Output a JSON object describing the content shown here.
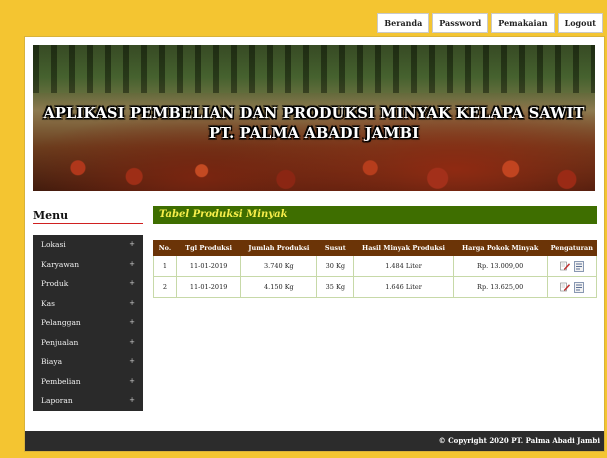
{
  "nav": {
    "items": [
      "Beranda",
      "Password",
      "Pemakaian",
      "Logout"
    ]
  },
  "banner": {
    "title_line1": "APLIKASI PEMBELIAN DAN  PRODUKSI MINYAK KELAPA SAWIT",
    "title_line2": "PT. PALMA ABADI JAMBI"
  },
  "sidebar": {
    "heading": "Menu",
    "items": [
      {
        "label": "Lokasi",
        "expander": "+"
      },
      {
        "label": "Karyawan",
        "expander": "+"
      },
      {
        "label": "Produk",
        "expander": "+"
      },
      {
        "label": "Kas",
        "expander": "+"
      },
      {
        "label": "Pelanggan",
        "expander": "+"
      },
      {
        "label": "Penjualan",
        "expander": "+"
      },
      {
        "label": "Biaya",
        "expander": "+"
      },
      {
        "label": "Pembelian",
        "expander": "+"
      },
      {
        "label": "Laporan",
        "expander": "+"
      }
    ]
  },
  "main": {
    "section_title": "Tabel Produksi Minyak",
    "table": {
      "headers": [
        "No.",
        "Tgl Produksi",
        "Jumlah Produksi",
        "Susut",
        "Hasil Minyak Produksi",
        "Harga Pokok Minyak",
        "Pengaturan"
      ],
      "rows": [
        {
          "no": "1",
          "tgl": "11-01-2019",
          "jumlah": "3.740 Kg",
          "susut": "30 Kg",
          "hasil": "1.484 Liter",
          "harga": "Rp. 13.009,00",
          "icons": [
            "edit-icon",
            "document-icon"
          ]
        },
        {
          "no": "2",
          "tgl": "11-01-2019",
          "jumlah": "4.150 Kg",
          "susut": "35 Kg",
          "hasil": "1.646 Liter",
          "harga": "Rp. 13.625,00",
          "icons": [
            "edit-icon",
            "document-icon"
          ]
        }
      ]
    }
  },
  "footer": {
    "copyright": "© Copyright 2020 PT. Palma Abadi Jambi"
  },
  "colors": {
    "page_background": "#f4c531",
    "section_title_bg": "#3e6e00",
    "section_title_text": "#f7ee4a",
    "table_header_bg": "#6b3407",
    "menu_bg": "#2a2a2a",
    "footer_bg": "#2c2c2c"
  }
}
